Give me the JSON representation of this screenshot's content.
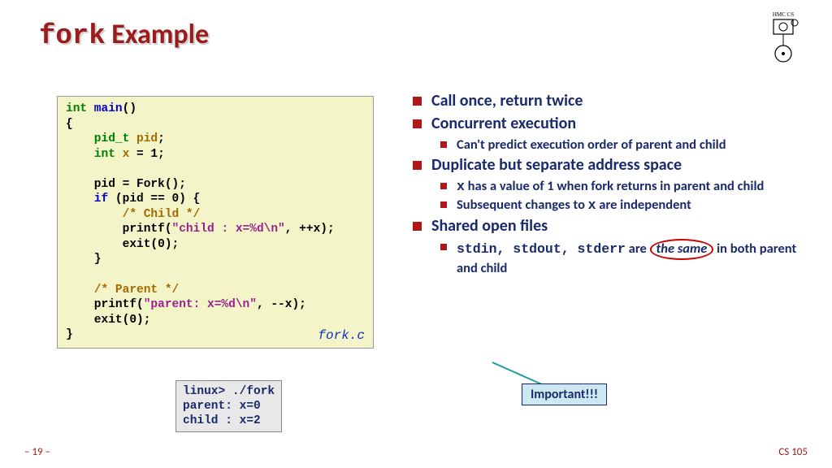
{
  "title_mono": "fork",
  "title_rest": " Example",
  "logo_label": "HMC CS",
  "code": {
    "l1a": "int",
    "l1b": " main",
    "l1c": "()",
    "l2": "{",
    "l3a": "    pid_t",
    "l3b": " pid",
    "l3c": ";",
    "l4a": "    int",
    "l4b": " x",
    "l4c": " = 1;",
    "l5": " ",
    "l6": "    pid = Fork();",
    "l7a": "    if",
    "l7b": " (pid == 0) {",
    "l8": "        /* Child */",
    "l9a": "        printf(",
    "l9b": "\"child : x=%d\\n\"",
    "l9c": ", ++x);",
    "l10": "        exit(0);",
    "l11": "    }",
    "l12": " ",
    "l13": "    /* Parent */",
    "l14a": "    printf(",
    "l14b": "\"parent: x=%d\\n\"",
    "l14c": ", --x);",
    "l15": "    exit(0);",
    "l16": "}",
    "filename": "fork.c"
  },
  "term": {
    "l1": "linux> ./fork",
    "l2": "parent: x=0",
    "l3": "child : x=2"
  },
  "bullets": {
    "b1": "Call once, return twice",
    "b2": "Concurrent execution",
    "b2a": "Can't predict execution order of parent and child",
    "b3": "Duplicate but separate address space",
    "b3a_pre": "x",
    "b3a_post": " has a value of 1 when fork returns in parent and child",
    "b3b_pre": "Subsequent changes to ",
    "b3b_mono": "x",
    "b3b_post": " are independent",
    "b4": "Shared open files",
    "b4a_mono": "stdin, stdout, stderr",
    "b4a_mid": " are ",
    "b4a_circ": "the same",
    "b4a_post": " in both parent and child"
  },
  "callout": "Important!!!",
  "pagenum": "– 19 –",
  "course": "CS 105"
}
